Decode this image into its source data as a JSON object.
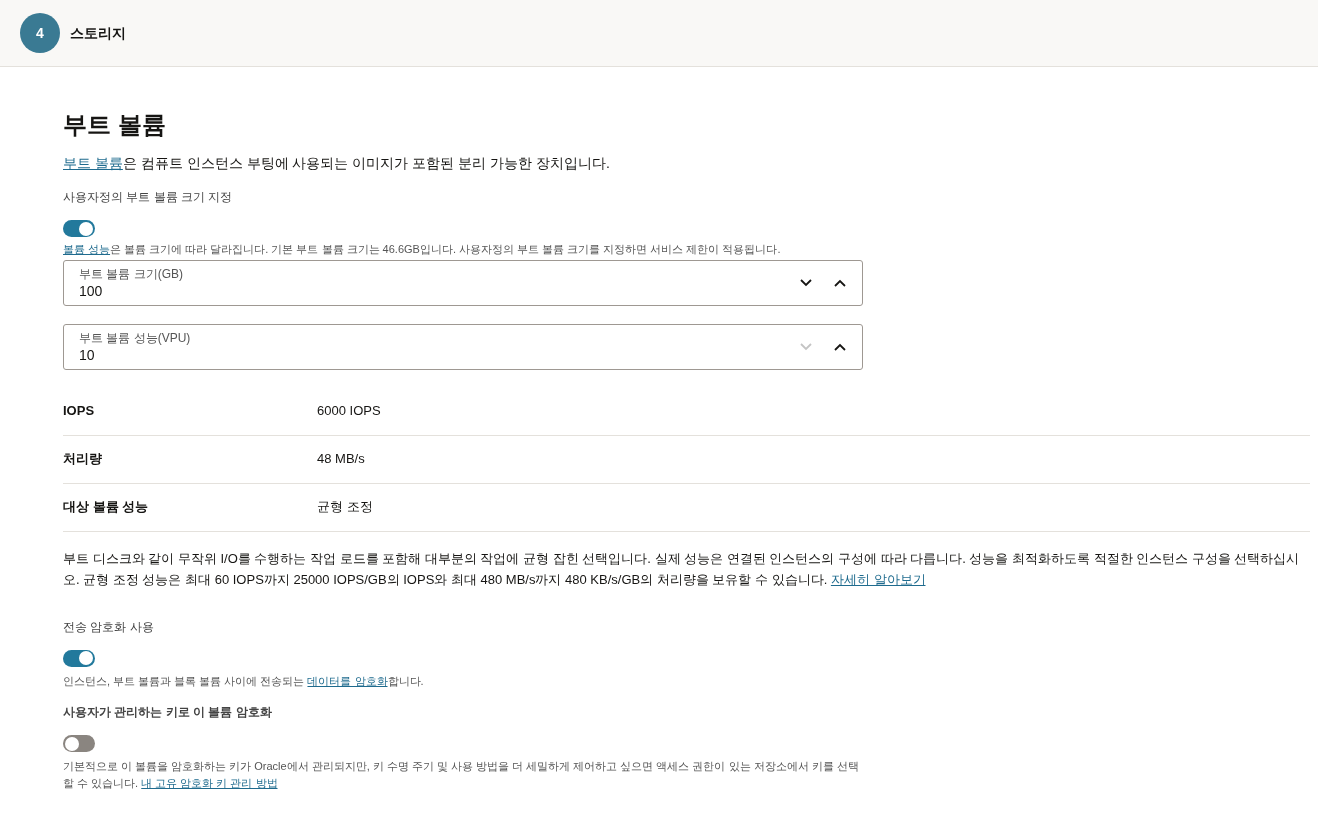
{
  "header": {
    "step": "4",
    "title": "스토리지"
  },
  "section": {
    "title": "부트 볼륨",
    "intro": {
      "link": "부트 볼륨",
      "after": "은 컴퓨트 인스턴스 부팅에 사용되는 이미지가 포함된 분리 가능한 장치입니다."
    },
    "custom_size": {
      "label": "사용자정의 부트 볼륨 크기 지정",
      "on": true,
      "help": {
        "link": "볼륨 성능",
        "after": "은 볼륨 크기에 따라 달라집니다. 기본 부트 볼륨 크기는 46.6GB입니다. 사용자정의 부트 볼륨 크기를 지정하면 서비스 제한이 적용됩니다."
      }
    },
    "fields": [
      {
        "label": "부트 볼륨 크기(GB)",
        "value": "100",
        "decrement_disabled": false
      },
      {
        "label": "부트 볼륨 성능(VPU)",
        "value": "10",
        "decrement_disabled": true
      }
    ],
    "metrics": [
      {
        "name": "IOPS",
        "value": "6000 IOPS"
      },
      {
        "name": "처리량",
        "value": "48 MB/s"
      },
      {
        "name": "대상 볼륨 성능",
        "value": "균형 조정"
      }
    ],
    "performance_note": {
      "before": "부트 디스크와 같이 무작위 I/O를 수행하는 작업 로드를 포함해 대부분의 작업에 균형 잡힌 선택입니다. 실제 성능은 연결된 인스턴스의 구성에 따라 다릅니다. 성능을 최적화하도록 적절한 인스턴스 구성을 선택하십시오. 균형 조정 성능은 최대 60 IOPS까지 25000 IOPS/GB의 IOPS와 최대 480 MB/s까지 480 KB/s/GB의 처리량을 보유할 수 있습니다. ",
      "link": "자세히 알아보기"
    },
    "in_transit": {
      "label": "전송 암호화 사용",
      "on": true,
      "help": {
        "before": "인스턴스, 부트 볼륨과 블록 볼륨 사이에 전송되는 ",
        "link": "데이터를 암호화",
        "after": "합니다."
      }
    },
    "own_key": {
      "label": "사용자가 관리하는 키로 이 볼륨 암호화",
      "on": false,
      "help": {
        "before": "기본적으로 이 볼륨을 암호화하는 키가 Oracle에서 관리되지만, 키 수명 주기 및 사용 방법을 더 세밀하게 제어하고 싶으면 액세스 권한이 있는 저장소에서 키를 선택할 수 있습니다. ",
        "link": "내 고유 암호화 키 관리 방법"
      }
    }
  }
}
